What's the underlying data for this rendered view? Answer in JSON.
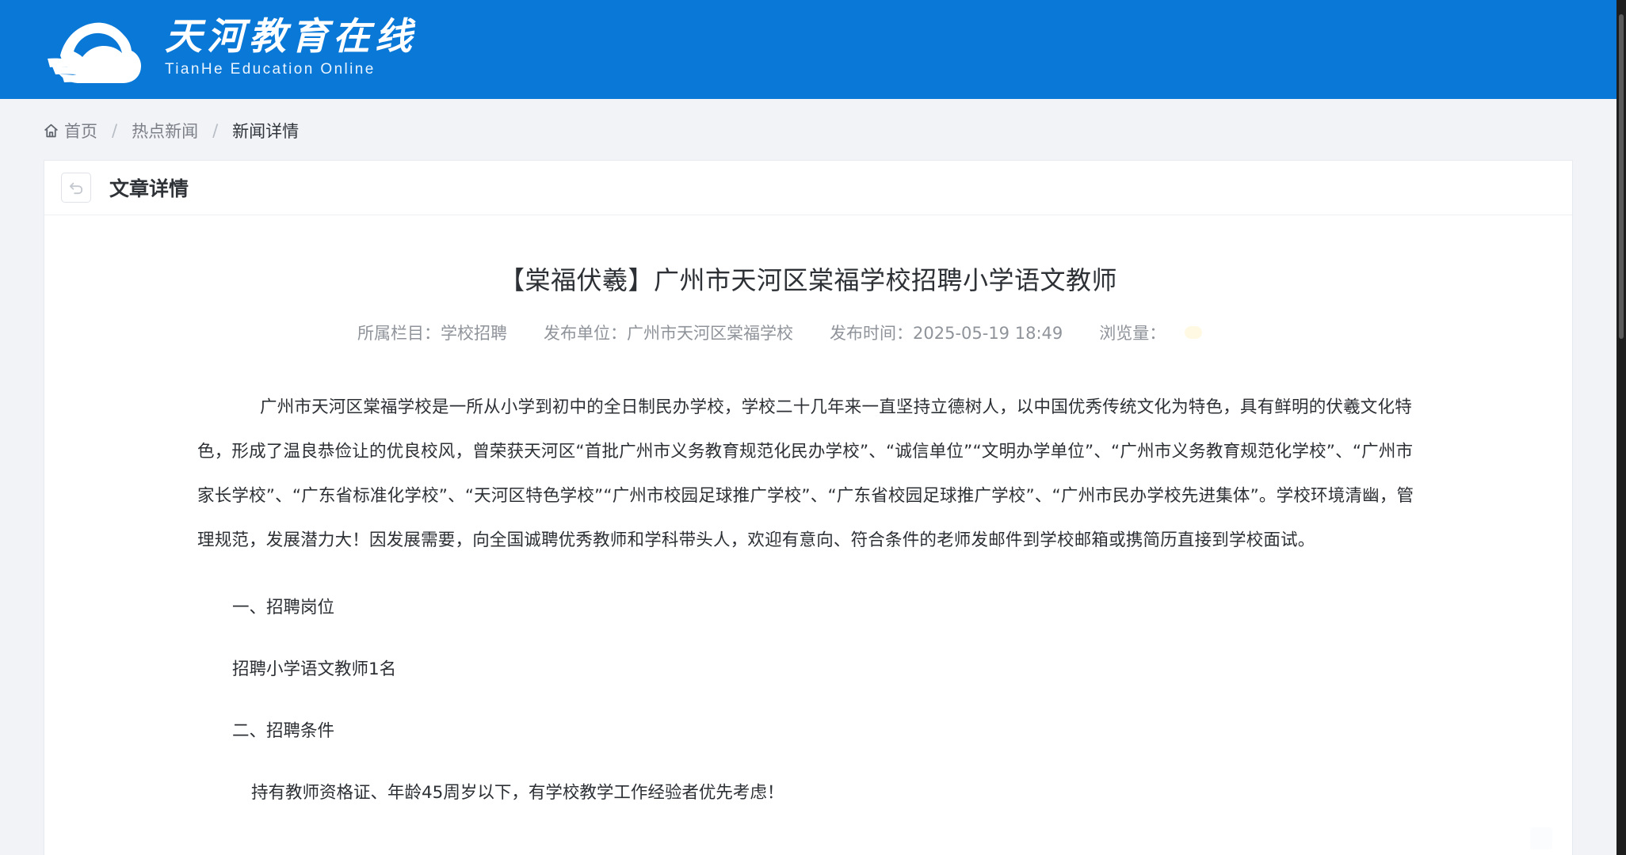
{
  "site": {
    "name_cn": "天河教育在线",
    "name_en": "TianHe Education Online"
  },
  "breadcrumb": {
    "home": "首页",
    "section": "热点新闻",
    "current": "新闻详情",
    "separator": "/"
  },
  "card": {
    "title": "文章详情"
  },
  "article": {
    "title": "【棠福伏羲】广州市天河区棠福学校招聘小学语文教师",
    "meta": {
      "category": "所属栏目：学校招聘",
      "publisher": "发布单位：广州市天河区棠福学校",
      "published_at": "发布时间：2025-05-19 18:49",
      "views": "浏览量："
    },
    "intro": "广州市天河区棠福学校是一所从小学到初中的全日制民办学校，学校二十几年来一直坚持立德树人，以中国优秀传统文化为特色，具有鲜明的伏羲文化特色，形成了温良恭俭让的优良校风，曾荣获天河区“首批广州市义务教育规范化民办学校”、“诚信单位”“文明办学单位”、“广州市义务教育规范化学校”、“广州市家长学校”、“广东省标准化学校”、“天河区特色学校”“广州市校园足球推广学校”、“广东省校园足球推广学校”、“广州市民办学校先进集体”。学校环境清幽，管理规范，发展潜力大！因发展需要，向全国诚聘优秀教师和学科带头人，欢迎有意向、符合条件的老师发邮件到学校邮箱或携简历直接到学校面试。",
    "section1": "一、招聘岗位",
    "positions": "招聘小学语文教师1名",
    "section2": "二、招聘条件",
    "conditions": "持有教师资格证、年龄45周岁以下，有学校教学工作经验者优先考虑！"
  },
  "colors": {
    "header": "#0a78d7",
    "page_bg": "#f1f3f7",
    "card_bg": "#ffffff",
    "text": "#2c3035"
  },
  "icons": {
    "logo": "cloud-wave-logo",
    "home": "home-icon",
    "back": "back-icon"
  }
}
